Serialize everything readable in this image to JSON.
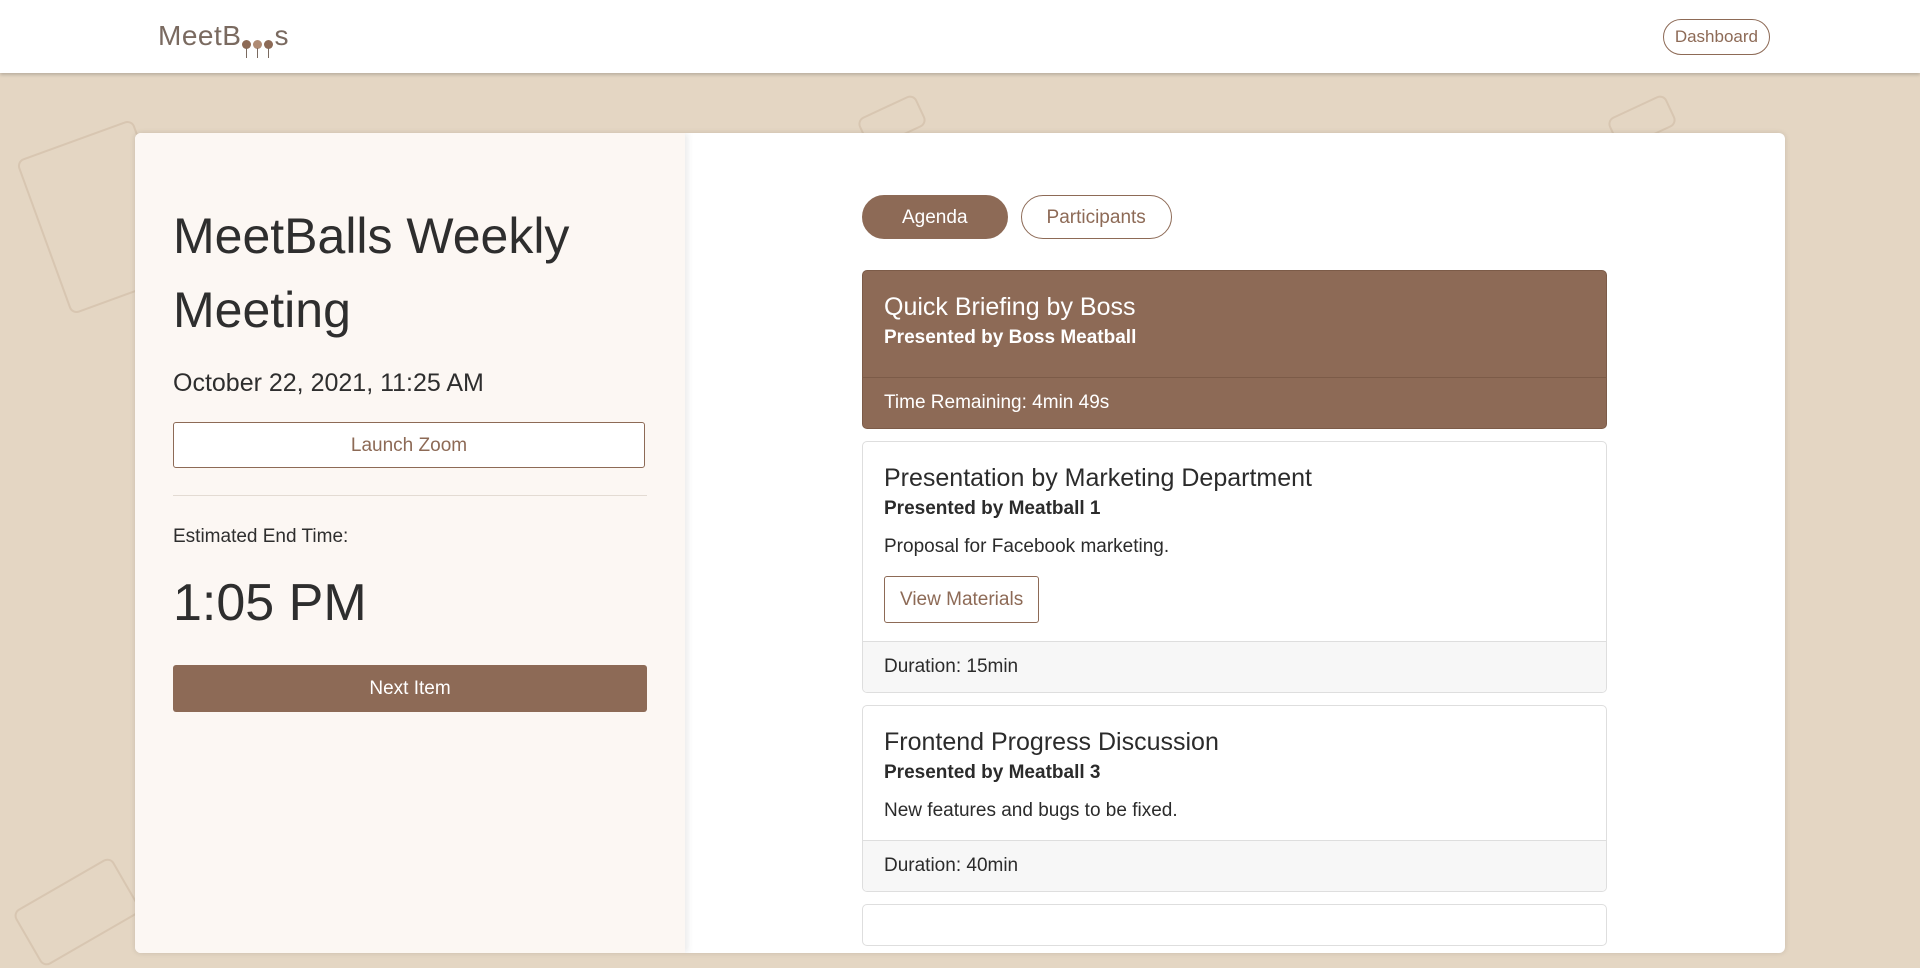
{
  "nav": {
    "logo_prefix": "MeetB",
    "logo_suffix": "s",
    "dashboard_label": "Dashboard"
  },
  "meeting": {
    "title": "MeetBalls Weekly Meeting",
    "datetime": "October 22, 2021, 11:25 AM",
    "launch_zoom_label": "Launch Zoom",
    "end_time_label": "Estimated End Time:",
    "end_time": "1:05 PM",
    "next_item_label": "Next Item"
  },
  "tabs": [
    {
      "label": "Agenda",
      "active": true
    },
    {
      "label": "Participants",
      "active": false
    }
  ],
  "agenda": [
    {
      "title": "Quick Briefing by Boss",
      "presenter": "Presented by Boss Meatball",
      "footer": "Time Remaining: 4min 49s"
    },
    {
      "title": "Presentation by Marketing Department",
      "presenter": "Presented by Meatball 1",
      "description": "Proposal for Facebook marketing.",
      "materials_label": "View Materials",
      "footer": "Duration: 15min"
    },
    {
      "title": "Frontend Progress Discussion",
      "presenter": "Presented by Meatball 3",
      "description": "New features and bugs to be fixed.",
      "footer": "Duration: 40min"
    }
  ],
  "colors": {
    "accent": "#8d6a56",
    "background": "#e4d6c3",
    "panel": "#fcf7f3"
  }
}
